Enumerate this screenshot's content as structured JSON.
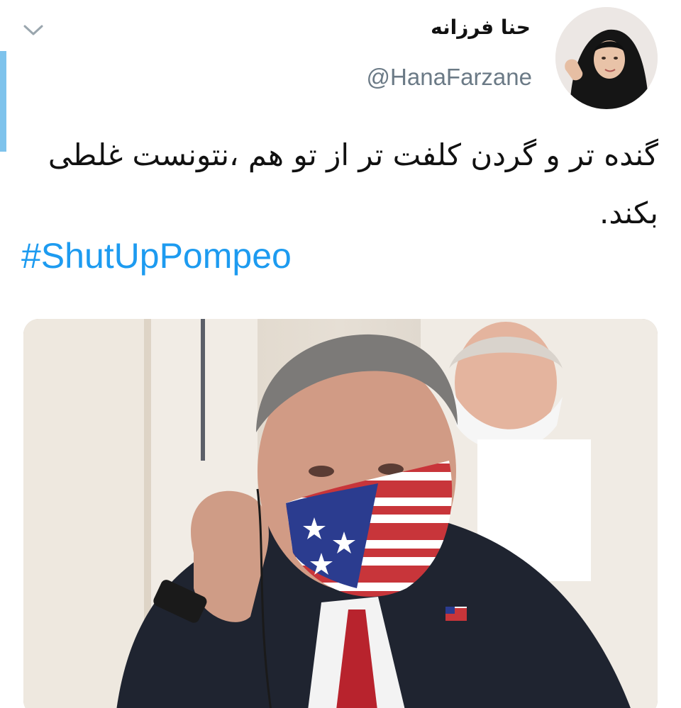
{
  "tweet": {
    "author": {
      "display_name": "حنا فرزانه",
      "handle": "@HanaFarzane",
      "avatar_icon": "profile-photo"
    },
    "menu_icon": "chevron-down-icon",
    "text": "گنده تر و گردن کلفت تر از تو هم ،نتونست غلطی بکند.",
    "hashtag": "#ShutUpPompeo",
    "media_description": "photo"
  },
  "colors": {
    "accent": "#1d9bf0",
    "handle": "#6b7a86",
    "text": "#111111",
    "left_bar": "#7ec3ec"
  }
}
